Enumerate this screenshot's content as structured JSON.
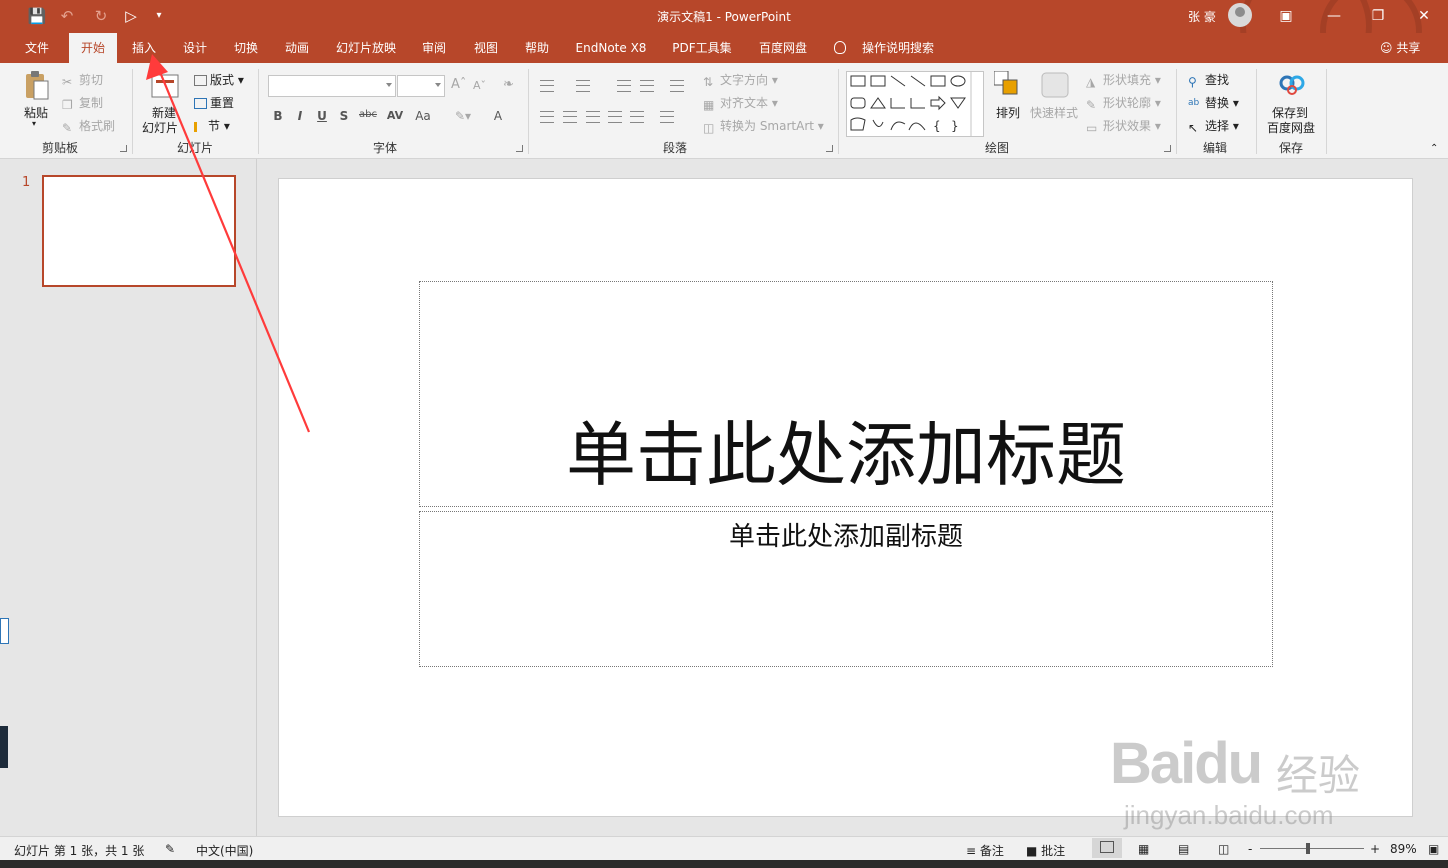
{
  "window": {
    "title": "演示文稿1  -  PowerPoint",
    "user": "张 豪"
  },
  "tabs": [
    {
      "label": "文件"
    },
    {
      "label": "开始"
    },
    {
      "label": "插入"
    },
    {
      "label": "设计"
    },
    {
      "label": "切换"
    },
    {
      "label": "动画"
    },
    {
      "label": "幻灯片放映"
    },
    {
      "label": "审阅"
    },
    {
      "label": "视图"
    },
    {
      "label": "帮助"
    },
    {
      "label": "EndNote X8"
    },
    {
      "label": "PDF工具集"
    },
    {
      "label": "百度网盘"
    }
  ],
  "tell_me": "操作说明搜索",
  "share": "共享",
  "ribbon": {
    "clipboard": {
      "paste": "粘贴",
      "cut": "剪切",
      "copy": "复制",
      "format_painter": "格式刷",
      "label": "剪贴板"
    },
    "slides": {
      "new_slide_1": "新建",
      "new_slide_2": "幻灯片",
      "layout": "版式",
      "reset": "重置",
      "section": "节",
      "label": "幻灯片"
    },
    "font": {
      "label": "字体",
      "bold": "B",
      "italic": "I",
      "underline": "U",
      "shadow": "S",
      "strike": "abc",
      "spacing": "AV",
      "case": "Aa",
      "color": "A"
    },
    "paragraph": {
      "text_direction": "文字方向",
      "align_text": "对齐文本",
      "smartart": "转换为 SmartArt",
      "label": "段落"
    },
    "drawing": {
      "arrange": "排列",
      "quick_styles": "快速样式",
      "shape_fill": "形状填充",
      "shape_outline": "形状轮廓",
      "shape_effects": "形状效果",
      "label": "绘图"
    },
    "editing": {
      "find": "查找",
      "replace": "替换",
      "select": "选择",
      "label": "编辑"
    },
    "save": {
      "save_to_1": "保存到",
      "save_to_2": "百度网盘",
      "label": "保存"
    }
  },
  "thumbnails": {
    "slide_number": "1"
  },
  "slide": {
    "title_placeholder": "单击此处添加标题",
    "subtitle_placeholder": "单击此处添加副标题"
  },
  "watermark": {
    "logo": "Baidu",
    "brand_cn": "经验",
    "url": "jingyan.baidu.com"
  },
  "status": {
    "slide_info": "幻灯片 第 1 张，共 1 张",
    "language": "中文(中国)",
    "notes": "备注",
    "comments": "批注",
    "zoom": "89%",
    "zoom_minus": "-",
    "zoom_plus": "+"
  },
  "colors": {
    "accent": "#b7472a",
    "ribbon_bg": "#f3f3f3",
    "annotation_arrow": "#ff3b3b"
  }
}
